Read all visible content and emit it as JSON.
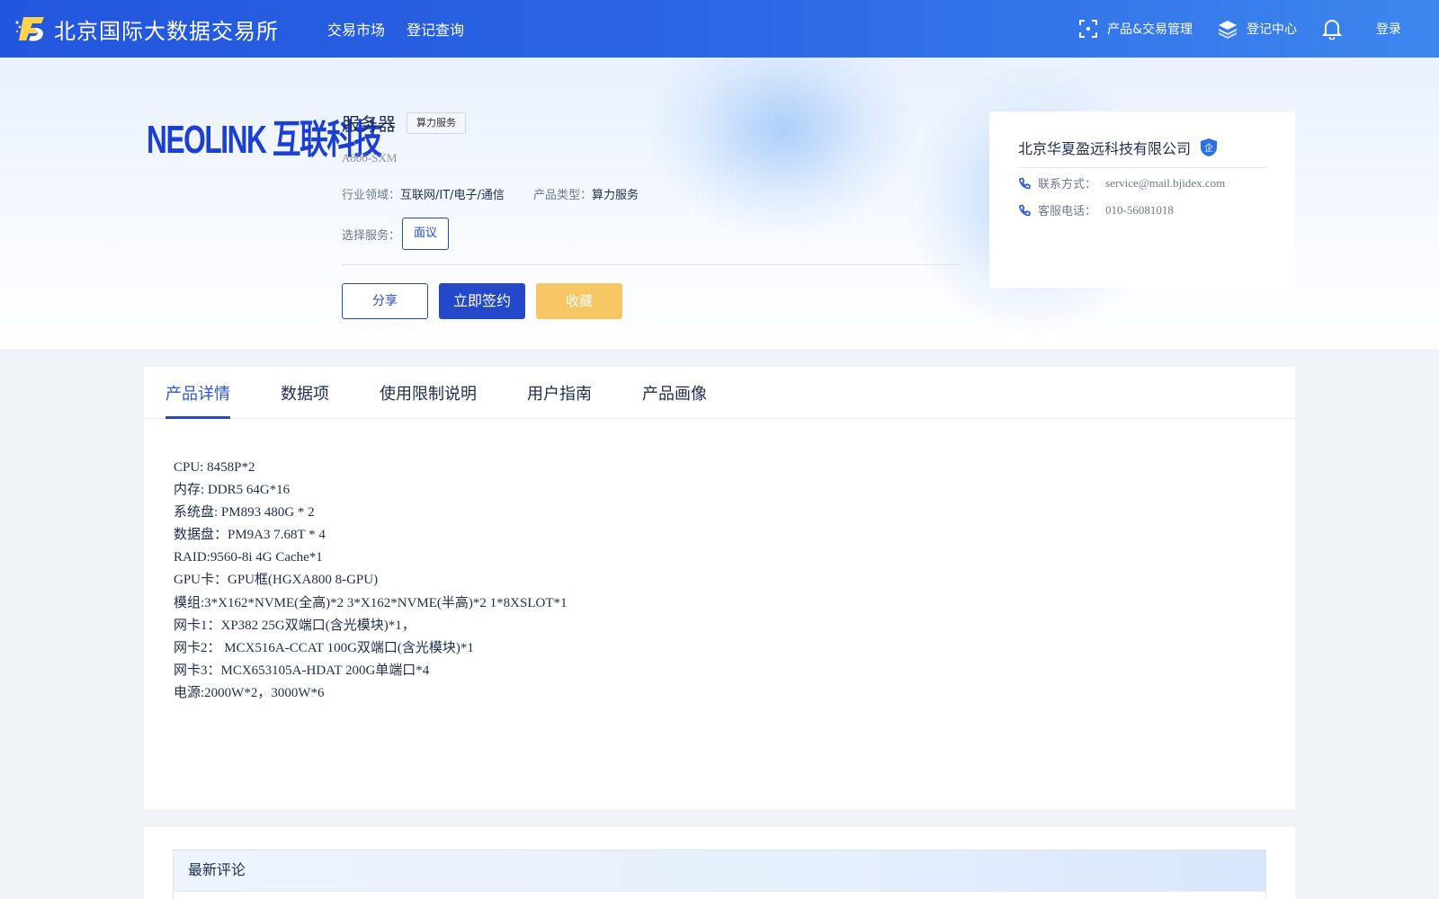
{
  "header": {
    "site_title": "北京国际大数据交易所",
    "nav": [
      "交易市场",
      "登记查询"
    ],
    "product_mgmt": "产品&交易管理",
    "register_center": "登记中心",
    "login": "登录"
  },
  "product": {
    "logo_text": "NEOLINK 互联科技",
    "name": "服务器",
    "tag": "算力服务",
    "model": "A800-SXM",
    "industry_label": "行业领域：",
    "industry_value": "互联网/IT/电子/通信",
    "type_label": "产品类型：",
    "type_value": "算力服务",
    "service_label": "选择服务：",
    "service_option": "面议",
    "share": "分享",
    "sign": "立即签约",
    "favorite": "收藏"
  },
  "company": {
    "name": "北京华夏盈远科技有限公司",
    "badge": "企",
    "contact_label": "联系方式：",
    "contact_value": "service@mail.bjidex.com",
    "phone_label": "客服电话：",
    "phone_value": "010-56081018"
  },
  "tabs": [
    "产品详情",
    "数据项",
    "使用限制说明",
    "用户指南",
    "产品画像"
  ],
  "active_tab": 0,
  "specs": [
    "CPU: 8458P*2",
    "内存: DDR5 64G*16",
    "系统盘: PM893 480G * 2",
    "数据盘：PM9A3 7.68T * 4",
    "RAID:9560-8i 4G Cache*1",
    "GPU卡：GPU框(HGXA800 8-GPU)",
    "模组:3*X162*NVME(全高)*2 3*X162*NVME(半高)*2 1*8XSLOT*1",
    "网卡1：XP382 25G双端口(含光模块)*1，",
    "网卡2： MCX516A-CCAT 100G双端口(含光模块)*1",
    "网卡3：MCX653105A-HDAT 200G单端口*4",
    "电源:2000W*2，3000W*6"
  ],
  "comments": {
    "title": "最新评论"
  },
  "colors": {
    "primary": "#2449c8",
    "favorite": "#f7c766",
    "topbar": "#2a64e3"
  }
}
